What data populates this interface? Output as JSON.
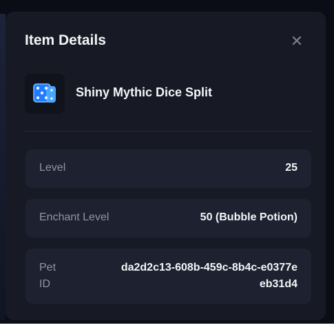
{
  "modal": {
    "title": "Item Details",
    "close_icon": "close-icon"
  },
  "item": {
    "name": "Shiny Mythic Dice Split",
    "icon": "blue-dice-icon"
  },
  "details": [
    {
      "label": "Level",
      "value": "25"
    },
    {
      "label": "Enchant Level",
      "value": "50 (Bubble Potion)"
    },
    {
      "label": "Pet ID",
      "value": "da2d2c13-608b-459c-8b4c-e0377eeb31d4"
    }
  ],
  "colors": {
    "modal_bg": "#171a24",
    "row_bg": "#1e2230",
    "accent_blue": "#2f8cff"
  }
}
